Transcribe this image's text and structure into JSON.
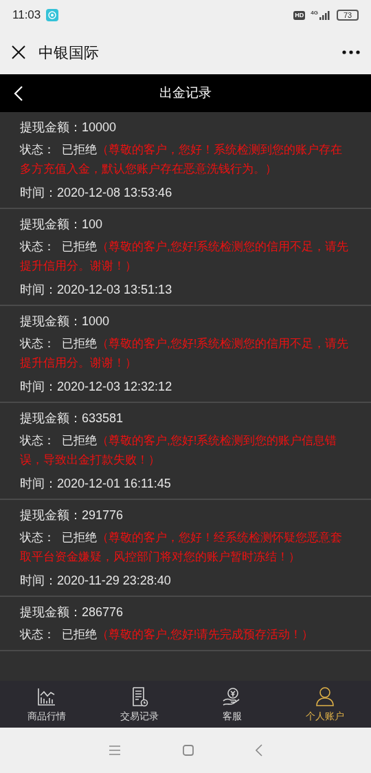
{
  "status_bar": {
    "time": "11:03",
    "hd": "HD",
    "network": "4G",
    "battery": "73"
  },
  "header": {
    "title": "中银国际"
  },
  "nav": {
    "title": "出金记录"
  },
  "records": [
    {
      "amount_label": "提现金额：",
      "amount": "10000",
      "status_label": "状态：",
      "status": "已拒绝",
      "message": "（尊敬的客户，您好！系统检测到您的账户存在多方充值入金，默认您账户存在恶意洗钱行为。）",
      "time_label": "时间：",
      "time": "2020-12-08 13:53:46"
    },
    {
      "amount_label": "提现金额：",
      "amount": "100",
      "status_label": "状态：",
      "status": "已拒绝",
      "message": "（尊敬的客户,您好!系统检测您的信用不足，请先提升信用分。谢谢！）",
      "time_label": "时间：",
      "time": "2020-12-03 13:51:13"
    },
    {
      "amount_label": "提现金额：",
      "amount": "1000",
      "status_label": "状态：",
      "status": "已拒绝",
      "message": "（尊敬的客户,您好!系统检测您的信用不足，请先提升信用分。谢谢！）",
      "time_label": "时间：",
      "time": "2020-12-03 12:32:12"
    },
    {
      "amount_label": "提现金额：",
      "amount": "633581",
      "status_label": "状态：",
      "status": "已拒绝",
      "message": "（尊敬的客户,您好!系统检测到您的账户信息错误，导致出金打款失败！）",
      "time_label": "时间：",
      "time": "2020-12-01 16:11:45"
    },
    {
      "amount_label": "提现金额：",
      "amount": "291776",
      "status_label": "状态：",
      "status": "已拒绝",
      "message": "（尊敬的客户，您好！经系统检测怀疑您恶意套取平台资金嫌疑，风控部门将对您的账户暂时冻结！）",
      "time_label": "时间：",
      "time": "2020-11-29 23:28:40"
    },
    {
      "amount_label": "提现金额：",
      "amount": "286776",
      "status_label": "状态：",
      "status": "已拒绝",
      "message": "（尊敬的客户,您好!请先完成预存活动！）"
    }
  ],
  "tabs": [
    {
      "kind": "chart",
      "label": "商品行情",
      "selected": false
    },
    {
      "kind": "document",
      "label": "交易记录",
      "selected": false
    },
    {
      "kind": "service",
      "label": "客服",
      "selected": false
    },
    {
      "kind": "user",
      "label": "个人账户",
      "selected": true
    }
  ]
}
